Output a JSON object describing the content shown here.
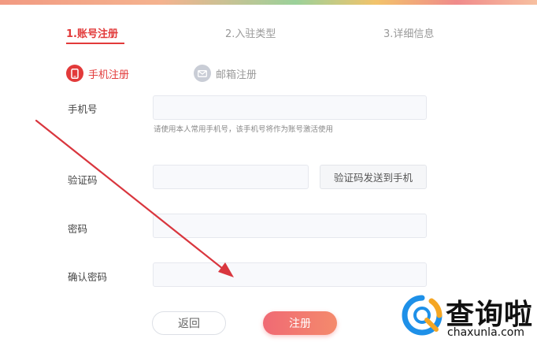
{
  "steps": [
    {
      "label": "1.账号注册"
    },
    {
      "label": "2.入驻类型"
    },
    {
      "label": "3.详细信息"
    }
  ],
  "reg_tabs": {
    "phone": {
      "label": "手机注册",
      "icon": "mobile-phone-icon"
    },
    "email": {
      "label": "邮箱注册",
      "icon": "envelope-icon"
    }
  },
  "form": {
    "phone": {
      "label": "手机号",
      "value": "",
      "hint": "请使用本人常用手机号，该手机号将作为账号激活使用"
    },
    "code": {
      "label": "验证码",
      "value": "",
      "send_button": "验证码发送到手机"
    },
    "password": {
      "label": "密码",
      "value": ""
    },
    "confirm": {
      "label": "确认密码",
      "value": ""
    }
  },
  "actions": {
    "back_label": "返回",
    "register_label": "注册"
  },
  "watermark": {
    "brand": "查询啦",
    "domain": "chaxunla.com"
  },
  "colors": {
    "accent": "#e23a3a",
    "register_button": "#f06a74",
    "arrow": "#d9363e"
  }
}
